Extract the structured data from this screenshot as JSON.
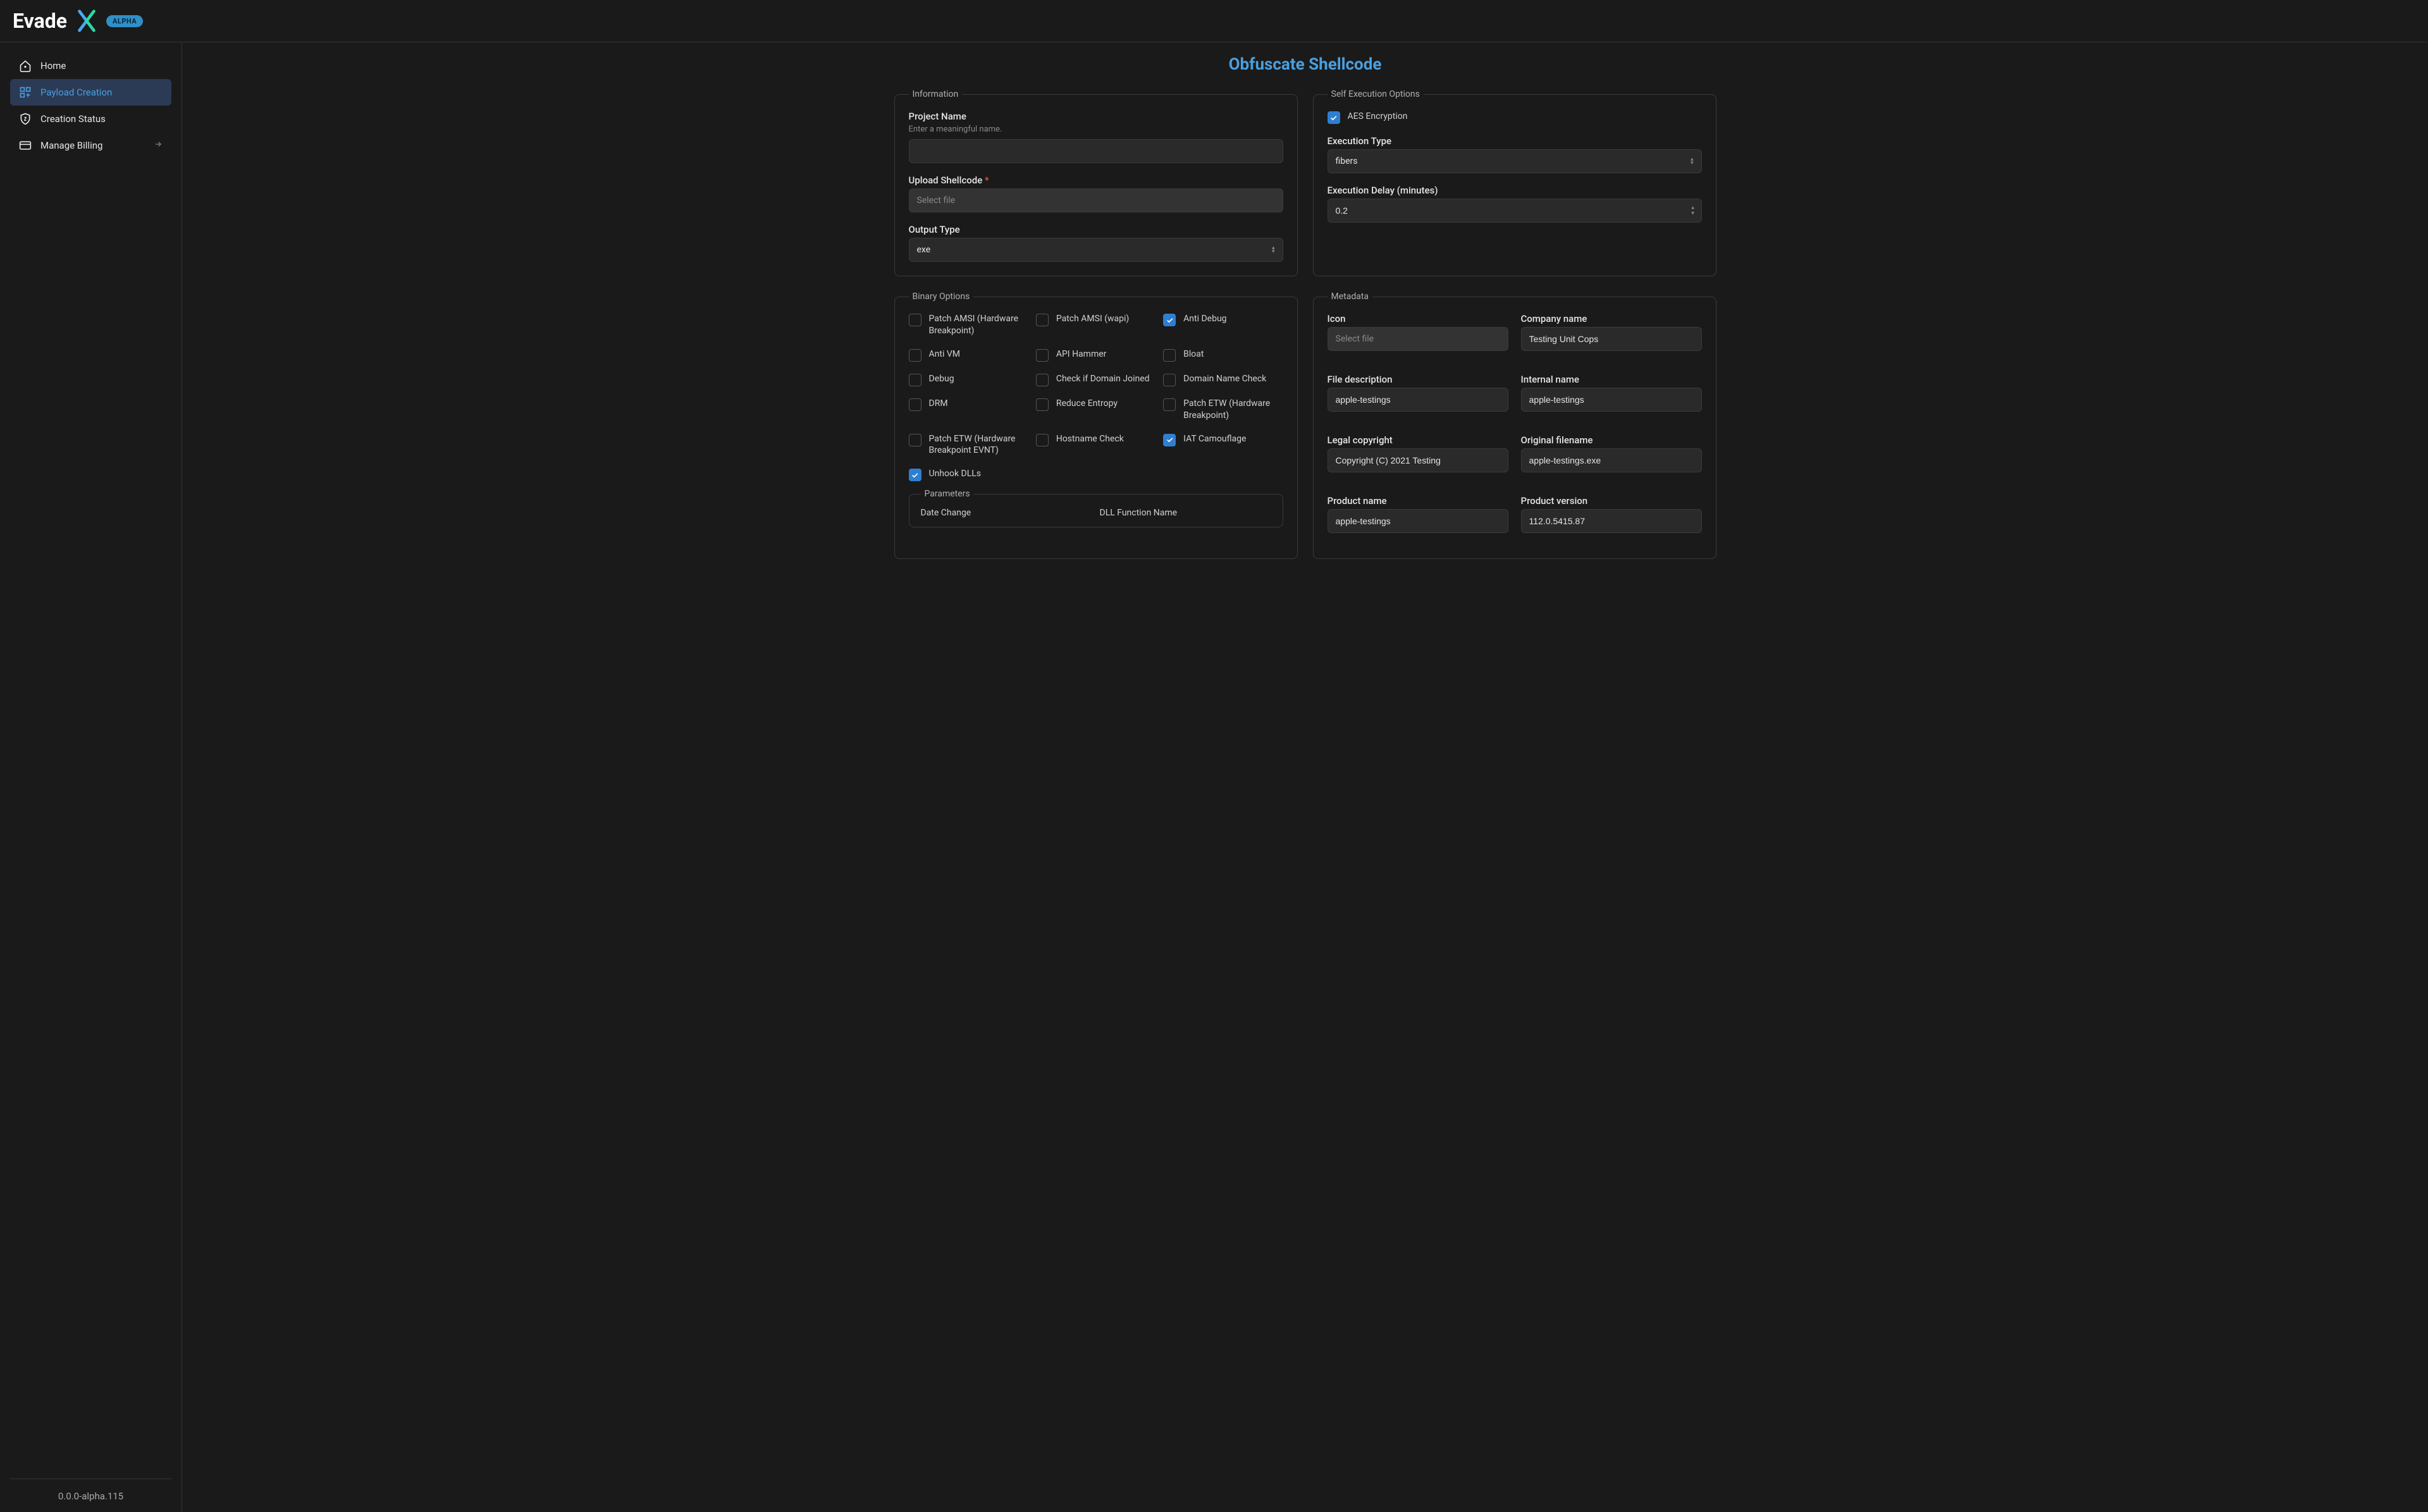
{
  "header": {
    "app_name": "Evade",
    "badge": "ALPHA"
  },
  "sidebar": {
    "items": [
      {
        "label": "Home",
        "active": false
      },
      {
        "label": "Payload Creation",
        "active": true
      },
      {
        "label": "Creation Status",
        "active": false
      },
      {
        "label": "Manage Billing",
        "active": false
      }
    ],
    "version": "0.0.0-alpha.115"
  },
  "page": {
    "title": "Obfuscate Shellcode"
  },
  "information": {
    "legend": "Information",
    "project_name_label": "Project Name",
    "project_name_hint": "Enter a meaningful name.",
    "project_name_value": "",
    "upload_label": "Upload Shellcode",
    "upload_placeholder": "Select file",
    "output_type_label": "Output Type",
    "output_type_value": "exe"
  },
  "self_exec": {
    "legend": "Self Execution Options",
    "aes_label": "AES Encryption",
    "aes_checked": true,
    "exec_type_label": "Execution Type",
    "exec_type_value": "fibers",
    "delay_label": "Execution Delay (minutes)",
    "delay_value": "0.2"
  },
  "binary_options": {
    "legend": "Binary Options",
    "items": [
      {
        "label": "Patch AMSI (Hardware Breakpoint)",
        "checked": false
      },
      {
        "label": "Patch AMSI (wapi)",
        "checked": false
      },
      {
        "label": "Anti Debug",
        "checked": true
      },
      {
        "label": "Anti VM",
        "checked": false
      },
      {
        "label": "API Hammer",
        "checked": false
      },
      {
        "label": "Bloat",
        "checked": false
      },
      {
        "label": "Debug",
        "checked": false
      },
      {
        "label": "Check if Domain Joined",
        "checked": false
      },
      {
        "label": "Domain Name Check",
        "checked": false
      },
      {
        "label": "DRM",
        "checked": false
      },
      {
        "label": "Reduce Entropy",
        "checked": false
      },
      {
        "label": "Patch ETW (Hardware Breakpoint)",
        "checked": false
      },
      {
        "label": "Patch ETW (Hardware Breakpoint EVNT)",
        "checked": false
      },
      {
        "label": "Hostname Check",
        "checked": false
      },
      {
        "label": "IAT Camouflage",
        "checked": true
      }
    ],
    "unhook_label": "Unhook DLLs",
    "unhook_checked": true,
    "params": {
      "legend": "Parameters",
      "date_change_label": "Date Change",
      "dll_func_label": "DLL Function Name"
    }
  },
  "metadata": {
    "legend": "Metadata",
    "fields": {
      "icon_label": "Icon",
      "icon_placeholder": "Select file",
      "company_label": "Company name",
      "company_value": "Testing Unit Cops",
      "file_desc_label": "File description",
      "file_desc_value": "apple-testings",
      "internal_label": "Internal name",
      "internal_value": "apple-testings",
      "legal_label": "Legal copyright",
      "legal_value": "Copyright (C) 2021 Testing",
      "orig_label": "Original filename",
      "orig_value": "apple-testings.exe",
      "product_label": "Product name",
      "product_value": "apple-testings",
      "version_label": "Product version",
      "version_value": "112.0.5415.87"
    }
  }
}
